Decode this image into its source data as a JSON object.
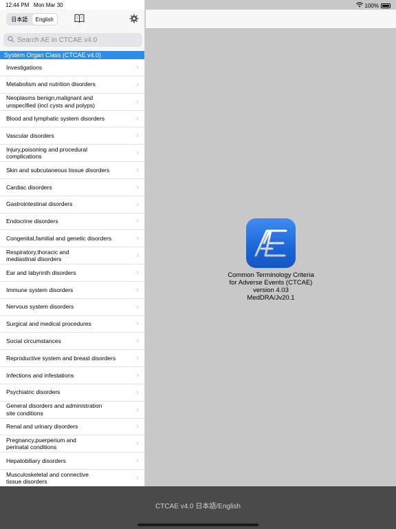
{
  "status": {
    "time": "12:44 PM",
    "date": "Mon Mar 30",
    "battery": "100%"
  },
  "toolbar": {
    "languages": [
      "日本語",
      "English"
    ],
    "active_language": "English"
  },
  "search": {
    "placeholder": "Search AE in CTCAE v4.0"
  },
  "section": {
    "title": "System Organ Class (CTCAE v4.0)"
  },
  "items": [
    {
      "label": "Investigations",
      "lines": 1
    },
    {
      "label": "Metabolism and nutrition disorders",
      "lines": 1
    },
    {
      "label": "Neoplasms benign,malignant and\nunspecified (incl cysts and polyps)",
      "lines": 2
    },
    {
      "label": "Blood and lymphatic system disorders",
      "lines": 1
    },
    {
      "label": "Vascular disorders",
      "lines": 1
    },
    {
      "label": "Injury,poisoning and procedural\ncomplications",
      "lines": 2
    },
    {
      "label": "Skin and subcutaneous tissue disorders",
      "lines": 1
    },
    {
      "label": "Cardiac disorders",
      "lines": 1
    },
    {
      "label": "Gastrointestinal disorders",
      "lines": 1
    },
    {
      "label": "Endocrine disorders",
      "lines": 1
    },
    {
      "label": "Congenital,familial and genetic disorders",
      "lines": 1
    },
    {
      "label": "Respiratory,thoracic and\nmediastinal disorders",
      "lines": 2
    },
    {
      "label": "Ear and labyrinth disorders",
      "lines": 1
    },
    {
      "label": "Immune system disorders",
      "lines": 1
    },
    {
      "label": "Nervous system disorders",
      "lines": 1
    },
    {
      "label": "Surgical and medical procedures",
      "lines": 1
    },
    {
      "label": "Social circumstances",
      "lines": 1
    },
    {
      "label": "Reproductive system and breast disorders",
      "lines": 1
    },
    {
      "label": "Infections and infestations",
      "lines": 1
    },
    {
      "label": "Psychiatric disorders",
      "lines": 1
    },
    {
      "label": "General disorders and administration\nsite conditions",
      "lines": 2
    },
    {
      "label": "Renal and urinary disorders",
      "lines": 1
    },
    {
      "label": "Pregnancy,puerperium and\nperinatal conditions",
      "lines": 2
    },
    {
      "label": "Hepatobiliary disorders",
      "lines": 1
    },
    {
      "label": "Musculoskeletal and connective\ntissue disorders",
      "lines": 2
    }
  ],
  "app": {
    "logo_text": "AE",
    "info_lines": [
      "Common Terminology Criteria",
      "for Adverse Events (CTCAE)",
      "version 4.03",
      "MedDRA/Jv20.1"
    ]
  },
  "footer": {
    "label": "CTCAE v4.0 日本語/English"
  },
  "colors": {
    "section_header": "#2f8ce6",
    "logo": "#1c66d8"
  }
}
